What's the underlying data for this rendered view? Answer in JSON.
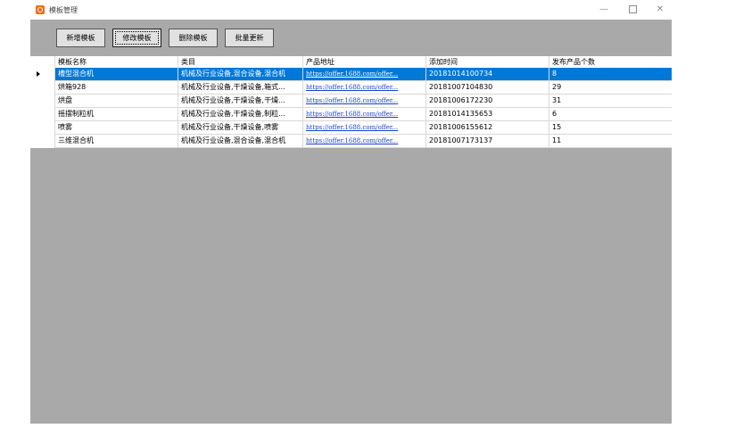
{
  "window": {
    "title": "模板管理",
    "minimize": "—",
    "close": "✕"
  },
  "toolbar": {
    "add_label": "新增模板",
    "edit_label": "修改模板",
    "delete_label": "删除模板",
    "batch_update_label": "批量更新"
  },
  "table": {
    "columns": [
      "模板名称",
      "类目",
      "产品地址",
      "添加时间",
      "发布产品个数"
    ],
    "rows": [
      {
        "name": "槽型混合机",
        "category": "机械及行业设备,混合设备,混合机",
        "url": "https://offer.1688.com/offer...",
        "time": "20181014100734",
        "count": "8"
      },
      {
        "name": "烘箱928",
        "category": "机械及行业设备,干燥设备,箱式...",
        "url": "https://offer.1688.com/offer...",
        "time": "20181007104830",
        "count": "29"
      },
      {
        "name": "烘盘",
        "category": "机械及行业设备,干燥设备,干燥...",
        "url": "https://offer.1688.com/offer...",
        "time": "20181006172230",
        "count": "31"
      },
      {
        "name": "摇摆制粒机",
        "category": "机械及行业设备,干燥设备,制粒...",
        "url": "https://offer.1688.com/offer...",
        "time": "20181014135653",
        "count": "6"
      },
      {
        "name": "喷雾",
        "category": "机械及行业设备,干燥设备,喷雾",
        "url": "https://offer.1688.com/offer...",
        "time": "20181006155612",
        "count": "15"
      },
      {
        "name": "三维混合机",
        "category": "机械及行业设备,混合设备,混合机",
        "url": "https://offer.1688.com/offer...",
        "time": "20181007173137",
        "count": "11"
      }
    ]
  },
  "colors": {
    "selection": "#0078d7",
    "panel_bg": "#a9a9a9",
    "link": "#1a3fd6",
    "app_icon": "#f26b1d"
  }
}
